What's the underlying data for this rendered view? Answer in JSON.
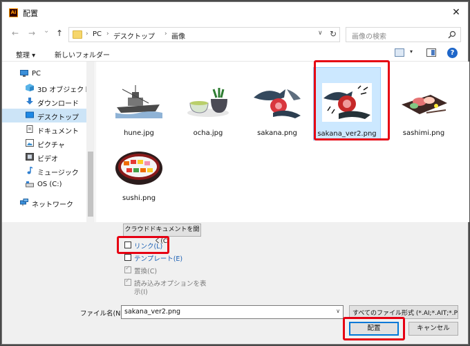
{
  "window": {
    "title": "配置",
    "app_icon": "Ai",
    "close_glyph": "✕"
  },
  "nav": {
    "back": "←",
    "forward": "→",
    "recent": "⌄",
    "up": "↑",
    "breadcrumb": [
      "PC",
      "デスクトップ",
      "画像"
    ],
    "breadcrumb_sep": "›",
    "dropdown": "∨",
    "refresh": "↻",
    "search_placeholder": "画像の検索"
  },
  "toolbar": {
    "organize": "整理 ▾",
    "new_folder": "新しいフォルダー",
    "help": "?",
    "view_dropdown": "▾"
  },
  "sidebar": {
    "items": [
      {
        "label": "PC",
        "icon": "pc-icon"
      },
      {
        "label": "3D オブジェクト",
        "icon": "3d-objects-icon"
      },
      {
        "label": "ダウンロード",
        "icon": "download-icon"
      },
      {
        "label": "デスクトップ",
        "icon": "desktop-icon",
        "selected": true
      },
      {
        "label": "ドキュメント",
        "icon": "document-icon"
      },
      {
        "label": "ピクチャ",
        "icon": "pictures-icon"
      },
      {
        "label": "ビデオ",
        "icon": "video-icon"
      },
      {
        "label": "ミュージック",
        "icon": "music-icon"
      },
      {
        "label": "OS (C:)",
        "icon": "drive-icon"
      },
      {
        "label": "ネットワーク",
        "icon": "network-icon"
      }
    ]
  },
  "files": [
    {
      "name": "hune.jpg",
      "thumb": "ship"
    },
    {
      "name": "ocha.jpg",
      "thumb": "tea"
    },
    {
      "name": "sakana.png",
      "thumb": "fish"
    },
    {
      "name": "sakana_ver2.png",
      "thumb": "fish2",
      "selected": true
    },
    {
      "name": "sashimi.png",
      "thumb": "sashimi"
    },
    {
      "name": "sushi.png",
      "thumb": "sushi"
    }
  ],
  "options": {
    "cloud_button": "クラウドドキュメントを開く(C)",
    "link": "リンク(L)",
    "template": "テンプレート(E)",
    "replace": "置換(C)",
    "import_options_line1": "読み込みオプションを表",
    "import_options_line2": "示(I)"
  },
  "footer": {
    "filename_label": "ファイル名(N):",
    "filename_value": "sakana_ver2.png",
    "filetype_value": "すべてのファイル形式 (*.AI;*.AIT;*.PDF",
    "place_button": "配置",
    "cancel_button": "キャンセル"
  },
  "colors": {
    "highlight": "#e60012",
    "selection": "#cce8ff",
    "link_blue": "#1a5fb4"
  }
}
